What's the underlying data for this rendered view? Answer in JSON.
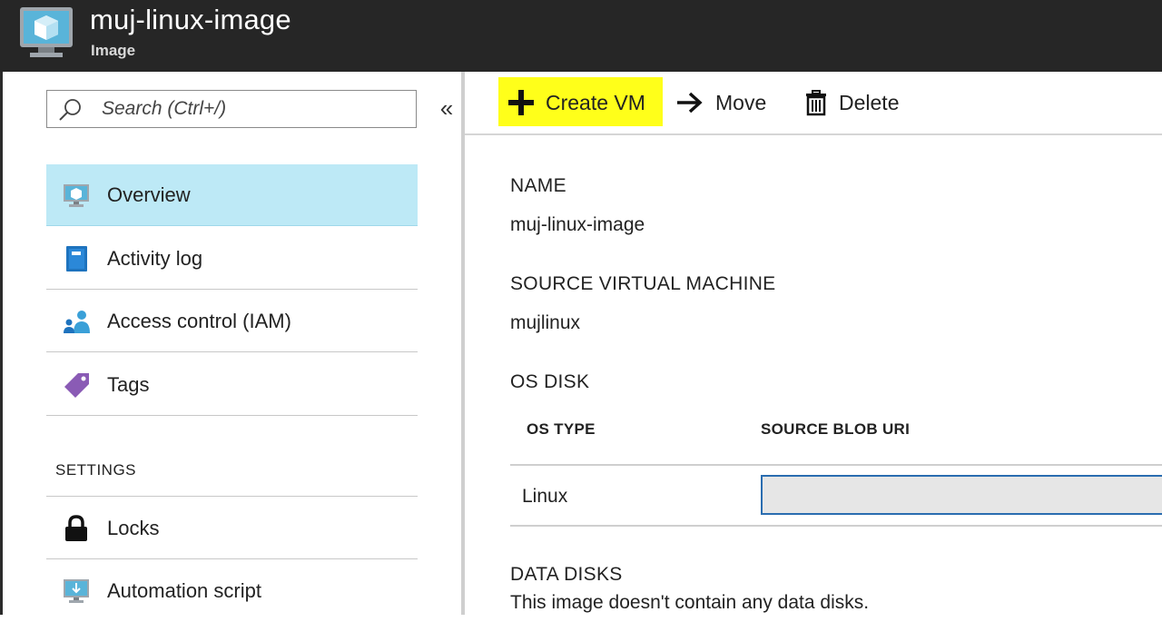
{
  "header": {
    "title": "muj-linux-image",
    "subtitle": "Image",
    "icon": "vm-image-icon"
  },
  "sidebar": {
    "search_placeholder": "Search (Ctrl+/)",
    "collapse_glyph": "«",
    "items": [
      {
        "label": "Overview",
        "icon": "monitor-icon",
        "active": true
      },
      {
        "label": "Activity log",
        "icon": "book-icon"
      },
      {
        "label": "Access control (IAM)",
        "icon": "users-icon"
      },
      {
        "label": "Tags",
        "icon": "tag-icon"
      }
    ],
    "settings_heading": "SETTINGS",
    "settings_items": [
      {
        "label": "Locks",
        "icon": "lock-icon"
      },
      {
        "label": "Automation script",
        "icon": "download-monitor-icon"
      }
    ]
  },
  "toolbar": {
    "create_vm": "Create VM",
    "move": "Move",
    "delete": "Delete",
    "create_highlight": "#ffff1a"
  },
  "details": {
    "name_label": "NAME",
    "name_value": "muj-linux-image",
    "source_vm_label": "SOURCE VIRTUAL MACHINE",
    "source_vm_value": "mujlinux",
    "os_disk_label": "OS DISK",
    "os_disk_table": {
      "columns": [
        "OS TYPE",
        "SOURCE BLOB URI"
      ],
      "rows": [
        [
          "Linux",
          ""
        ]
      ]
    },
    "data_disks_label": "DATA DISKS",
    "data_disks_text": "This image doesn't contain any data disks."
  },
  "colors": {
    "header_bg": "#262626",
    "active_item_bg": "#bde9f6",
    "accent_blue": "#2a6db0"
  }
}
